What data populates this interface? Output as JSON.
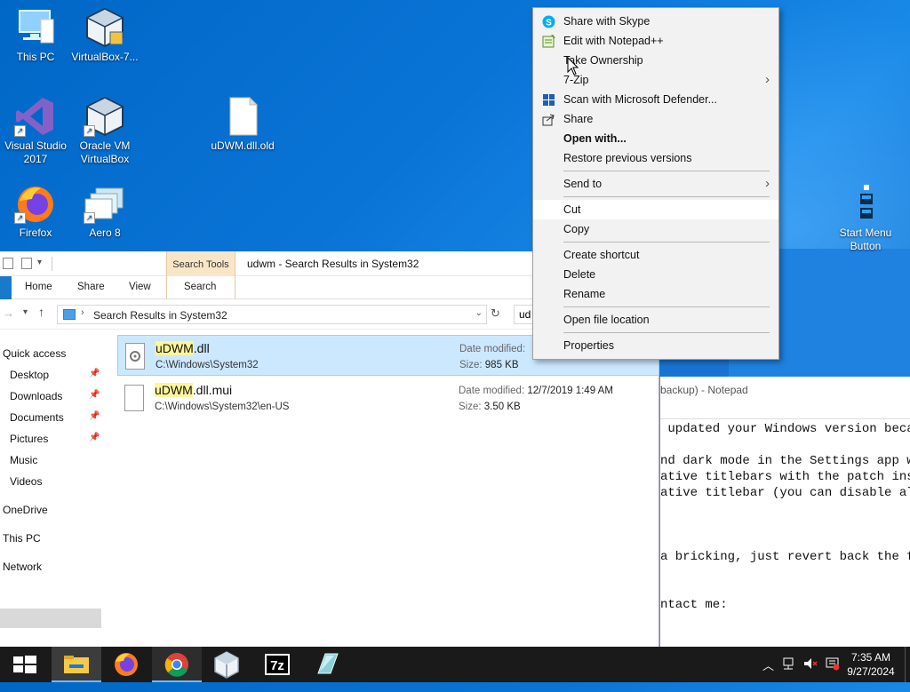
{
  "desktop": {
    "icons": [
      {
        "label": "This PC"
      },
      {
        "label": "VirtualBox-7..."
      },
      {
        "label": "Visual Studio 2017"
      },
      {
        "label": "Oracle VM VirtualBox"
      },
      {
        "label": "uDWM.dll.old"
      },
      {
        "label": "Firefox"
      },
      {
        "label": "Aero 8"
      },
      {
        "label": "Start Menu Button"
      }
    ]
  },
  "explorer": {
    "title": "udwm - Search Results in System32",
    "search_tools_tab": "Search Tools",
    "tabs": [
      "Home",
      "Share",
      "View",
      "Search"
    ],
    "address": "Search Results in System32",
    "search_value": "ud",
    "nav": {
      "quick_access": "Quick access",
      "items": [
        "Desktop",
        "Downloads",
        "Documents",
        "Pictures",
        "Music",
        "Videos"
      ],
      "onedrive": "OneDrive",
      "this_pc": "This PC",
      "network": "Network"
    },
    "files": [
      {
        "name_hl": "uDWM",
        "name_rest": ".dll",
        "path": "C:\\Windows\\System32",
        "date_label": "Date modified:",
        "date": "",
        "size_label": "Size:",
        "size": "985 KB"
      },
      {
        "name_hl": "uDWM",
        "name_rest": ".dll.mui",
        "path": "C:\\Windows\\System32\\en-US",
        "date_label": "Date modified:",
        "date": "12/7/2019 1:49 AM",
        "size_label": "Size:",
        "size": "3.50 KB"
      }
    ]
  },
  "notepad": {
    "title": "backup) - Notepad",
    "lines": [
      " updated your Windows version becau",
      "nd dark mode in the Settings app wi",
      "ative titlebars with the patch inst",
      "ative titlebar (you can disable all",
      "a bricking, just revert back the fi",
      "ntact me:"
    ]
  },
  "context_menu": {
    "items": {
      "skype": "Share with Skype",
      "notepadpp": "Edit with Notepad++",
      "ownership": "Take Ownership",
      "zip": "7-Zip",
      "defender": "Scan with Microsoft Defender...",
      "share": "Share",
      "open_with": "Open with...",
      "restore": "Restore previous versions",
      "send_to": "Send to",
      "cut": "Cut",
      "copy": "Copy",
      "create_shortcut": "Create shortcut",
      "delete": "Delete",
      "rename": "Rename",
      "open_location": "Open file location",
      "properties": "Properties"
    }
  },
  "taskbar": {
    "time": "7:35 AM",
    "date": "9/27/2024",
    "seven_zip_label": "7z"
  },
  "colors": {
    "accent": "#1979ca",
    "selection": "#cce8ff",
    "highlight": "#fff59a",
    "taskbar": "#1a1a1a"
  }
}
